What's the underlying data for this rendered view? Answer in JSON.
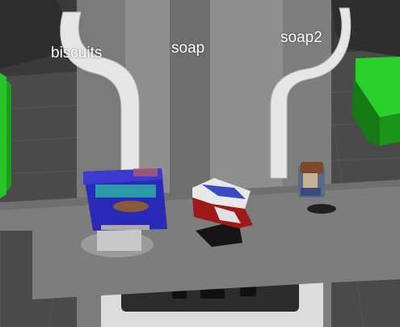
{
  "scene": {
    "objects": [
      {
        "id": "biscuits",
        "label": "biscuits"
      },
      {
        "id": "soap",
        "label": "soap"
      },
      {
        "id": "soap2",
        "label": "soap2"
      }
    ]
  },
  "colors": {
    "background": "#3a3a3a",
    "floor": "#4d4d4d",
    "robot_body": "#9a9a9a",
    "robot_white": "#e8e8e8",
    "table": "#7c7c7c",
    "shelf_green": "#1fb31f",
    "biscuit_box_blue": "#2a2ab8",
    "soap_red": "#a01818",
    "soap2_brown": "#7a4a2a"
  }
}
